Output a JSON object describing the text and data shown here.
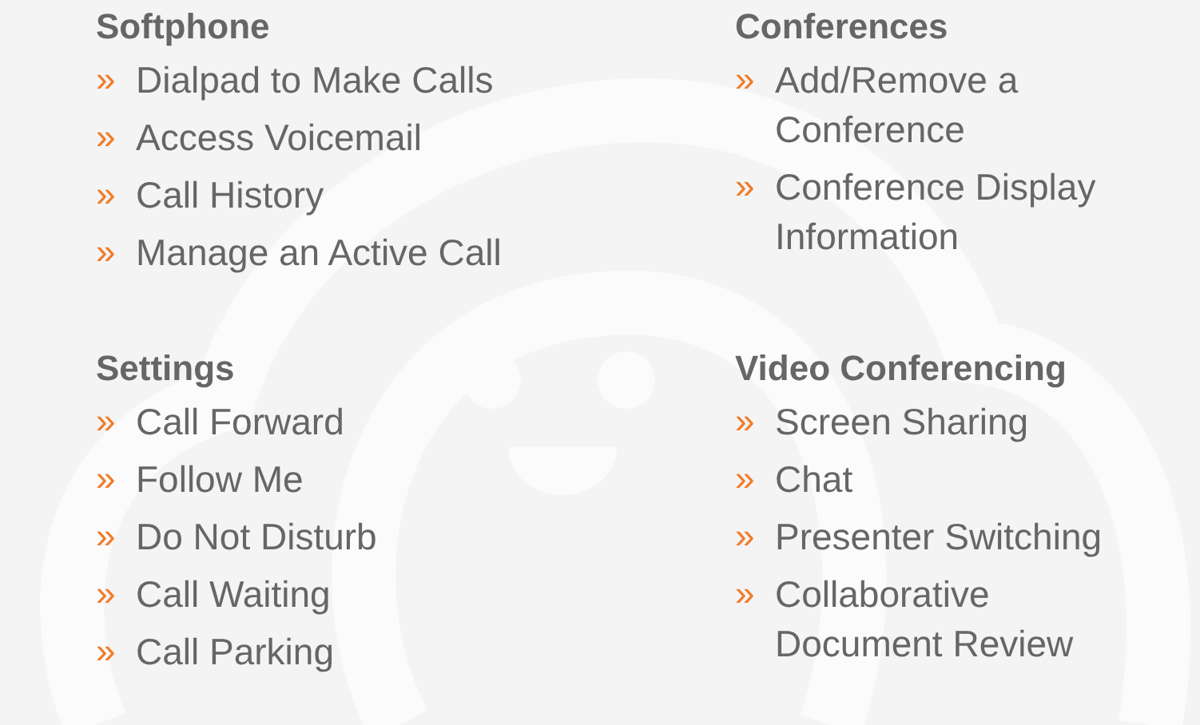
{
  "sections": [
    {
      "heading": "Softphone",
      "items": [
        {
          "bullet": "»",
          "label": "Dialpad to Make Calls"
        },
        {
          "bullet": "»",
          "label": "Access Voicemail"
        },
        {
          "bullet": "»",
          "label": "Call History"
        },
        {
          "bullet": "»",
          "label": "Manage an Active Call"
        }
      ]
    },
    {
      "heading": "Conferences",
      "items": [
        {
          "bullet": "»",
          "label": "Add/Remove a Conference"
        },
        {
          "bullet": "»",
          "label": "Conference Display Information"
        }
      ]
    },
    {
      "heading": "Settings",
      "items": [
        {
          "bullet": "»",
          "label": "Call Forward"
        },
        {
          "bullet": "»",
          "label": "Follow Me"
        },
        {
          "bullet": "»",
          "label": "Do Not Disturb"
        },
        {
          "bullet": "»",
          "label": "Call Waiting"
        },
        {
          "bullet": "»",
          "label": "Call Parking"
        }
      ]
    },
    {
      "heading": "Video Conferencing",
      "items": [
        {
          "bullet": "»",
          "label": "Screen Sharing"
        },
        {
          "bullet": "»",
          "label": "Chat"
        },
        {
          "bullet": "»",
          "label": "Presenter Switching"
        },
        {
          "bullet": "»",
          "label": "Collaborative Document Review"
        }
      ]
    }
  ]
}
